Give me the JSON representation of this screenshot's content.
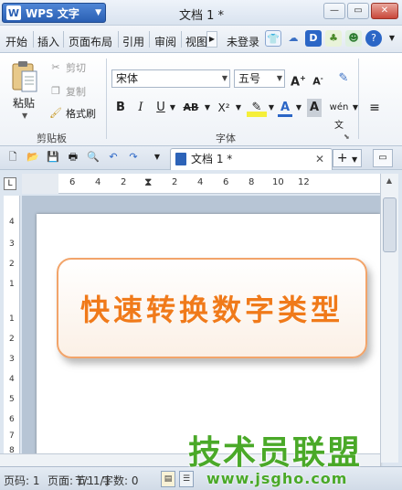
{
  "app": {
    "name": "WPS 文字",
    "logo": "W",
    "window_title": "文档 1 *"
  },
  "menu": {
    "items": [
      "开始",
      "插入",
      "页面布局",
      "引用",
      "审阅",
      "视图"
    ],
    "login": "未登录"
  },
  "ribbon": {
    "paste_label": "粘贴",
    "cut_label": "剪切",
    "copy_label": "复制",
    "format_painter_label": "格式刷",
    "clipboard_group": "剪贴板",
    "font_name": "宋体",
    "font_size": "五号",
    "font_group": "字体",
    "bold": "B",
    "italic": "I",
    "underline": "U",
    "strikethrough": "AB",
    "superscript": "X²",
    "phonetic": "wén 文"
  },
  "doc_tab": {
    "label": "文档 1 *"
  },
  "ruler": {
    "h_numbers": [
      "6",
      "4",
      "2",
      "2",
      "4",
      "6",
      "8",
      "10",
      "12"
    ],
    "v_numbers": [
      "4",
      "3",
      "2",
      "1",
      "1",
      "2",
      "3",
      "4",
      "5",
      "6",
      "7",
      "8"
    ]
  },
  "document": {
    "textbox_text": "快速转换数字类型"
  },
  "status": {
    "page": "页码: 1",
    "pages": "页面: 1/1",
    "section": "节: 1/1",
    "words": "字数: 0"
  },
  "watermark": {
    "main": "技术员联盟",
    "url": "www.jsgho.com"
  }
}
